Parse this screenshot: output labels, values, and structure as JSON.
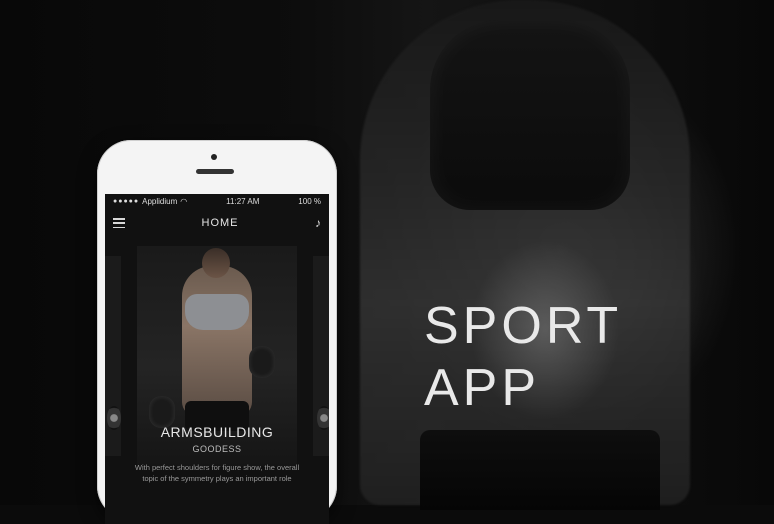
{
  "hero": {
    "title_line1": "SPORT",
    "title_line2": "APP"
  },
  "phone": {
    "status": {
      "carrier": "Applidium",
      "time": "11:27 AM",
      "battery": "100 %"
    },
    "nav": {
      "title": "HOME",
      "menu_icon": "hamburger-menu-icon",
      "music_icon": "music-note-icon"
    },
    "card": {
      "title": "ARMSBUILDING",
      "subtitle": "GOODESS",
      "description": "With perfect shoulders for figure show, the overall topic of the symmetry plays an important role"
    }
  },
  "colors": {
    "background": "#0b0b0b",
    "hero_text": "#e9e9e9",
    "phone_body": "#f4f4f4",
    "screen_bg": "#111111"
  }
}
